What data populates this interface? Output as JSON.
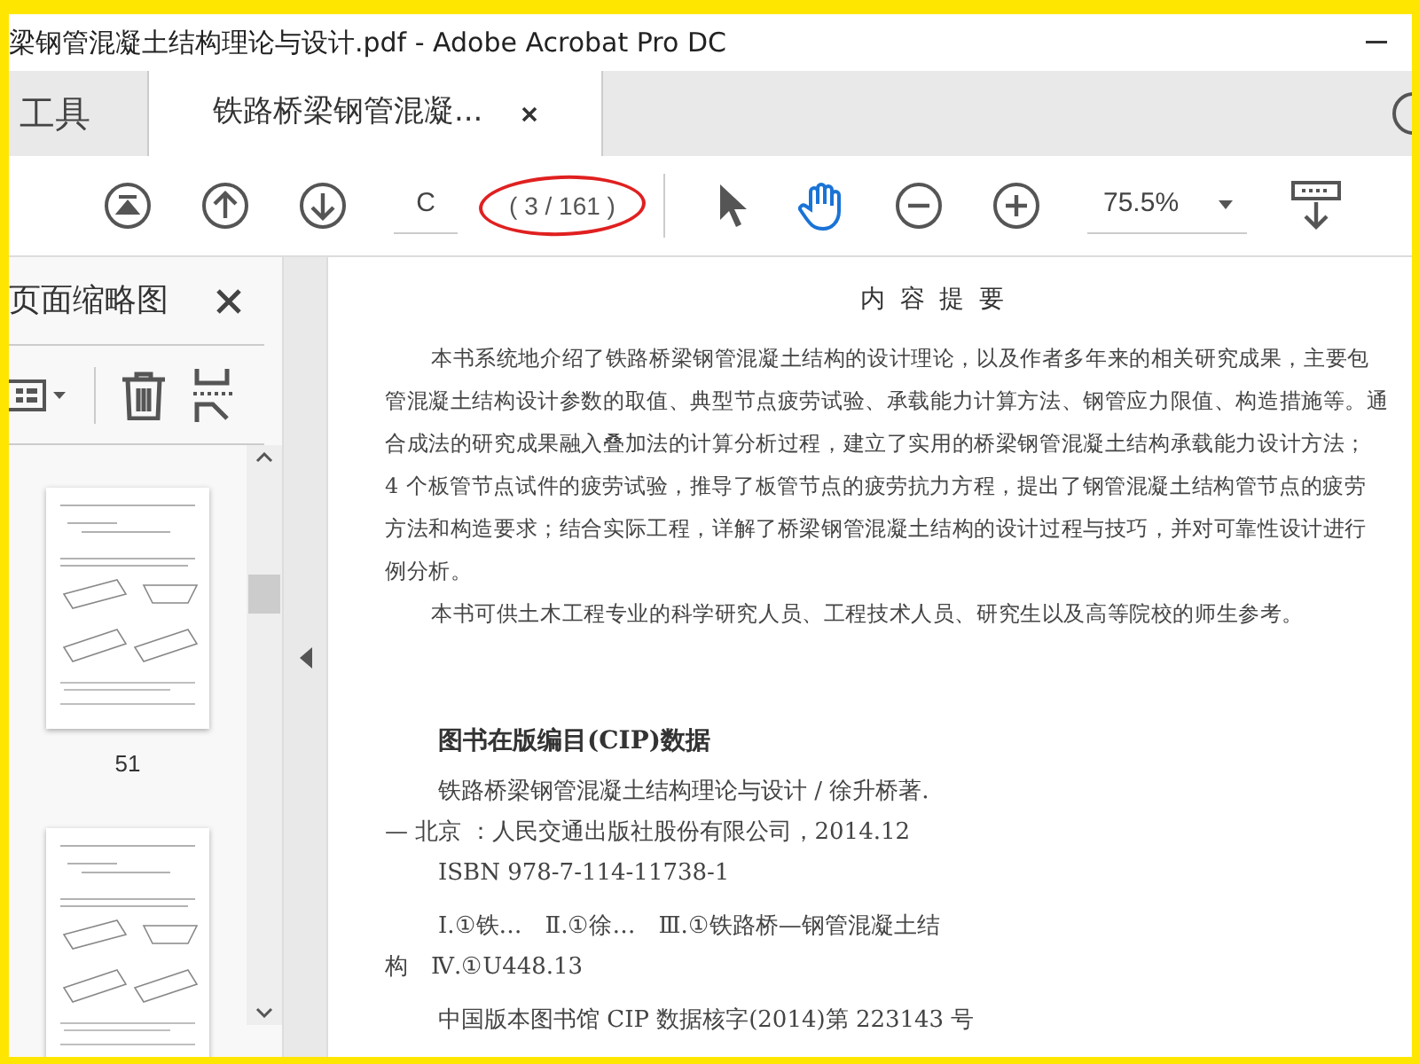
{
  "window": {
    "title": "梁钢管混凝土结构理论与设计.pdf - Adobe Acrobat Pro DC"
  },
  "tabs": [
    {
      "label": "工具",
      "selected": false,
      "closable": false
    },
    {
      "label": "铁路桥梁钢管混凝...",
      "selected": true,
      "closable": true
    }
  ],
  "toolbar": {
    "page_field": "C",
    "page_count": "( 3 / 161 )",
    "page_count_circled": true,
    "tools": [
      {
        "kind": "pointer",
        "selected": false
      },
      {
        "kind": "hand",
        "selected": true
      }
    ],
    "zoom": "75.5%"
  },
  "sidebar": {
    "title": "页面缩略图",
    "thumbnails": [
      {
        "label": "51"
      }
    ]
  },
  "document": {
    "heading": "内 容 提 要",
    "paragraphs": [
      [
        "本书系统地介绍了铁路桥梁钢管混凝土结构的设计理论，以及作者多年来的相关研究成果，主要包",
        "管混凝土结构设计参数的取值、典型节点疲劳试验、承载能力计算方法、钢管应力限值、构造措施等。通",
        "合成法的研究成果融入叠加法的计算分析过程，建立了实用的桥梁钢管混凝土结构承载能力设计方法；",
        "4 个板管节点试件的疲劳试验，推导了板管节点的疲劳抗力方程，提出了钢管混凝土结构管节点的疲劳",
        "方法和构造要求；结合实际工程，详解了桥梁钢管混凝土结构的设计过程与技巧，并对可靠性设计进行",
        "例分析。"
      ],
      [
        "本书可供土木工程专业的科学研究人员、工程技术人员、研究生以及高等院校的师生参考。"
      ]
    ],
    "cip_heading": "图书在版编目(CIP)数据",
    "cip_lines": [
      {
        "text": "铁路桥梁钢管混凝土结构理论与设计 / 徐升桥著.",
        "hanging": false
      },
      {
        "text": "— 北京 ：人民交通出版社股份有限公司，2014.12",
        "hanging": true
      },
      {
        "text": "ISBN 978-7-114-11738-1",
        "hanging": false
      },
      {
        "text": "Ⅰ.①铁…　Ⅱ.①徐…　Ⅲ.①铁路桥—钢管混凝土结",
        "hanging": false
      },
      {
        "text": "构　Ⅳ.①U448.13",
        "hanging": true
      },
      {
        "text": "中国版本图书馆 CIP 数据核字(2014)第 223143 号",
        "hanging": false
      }
    ]
  }
}
